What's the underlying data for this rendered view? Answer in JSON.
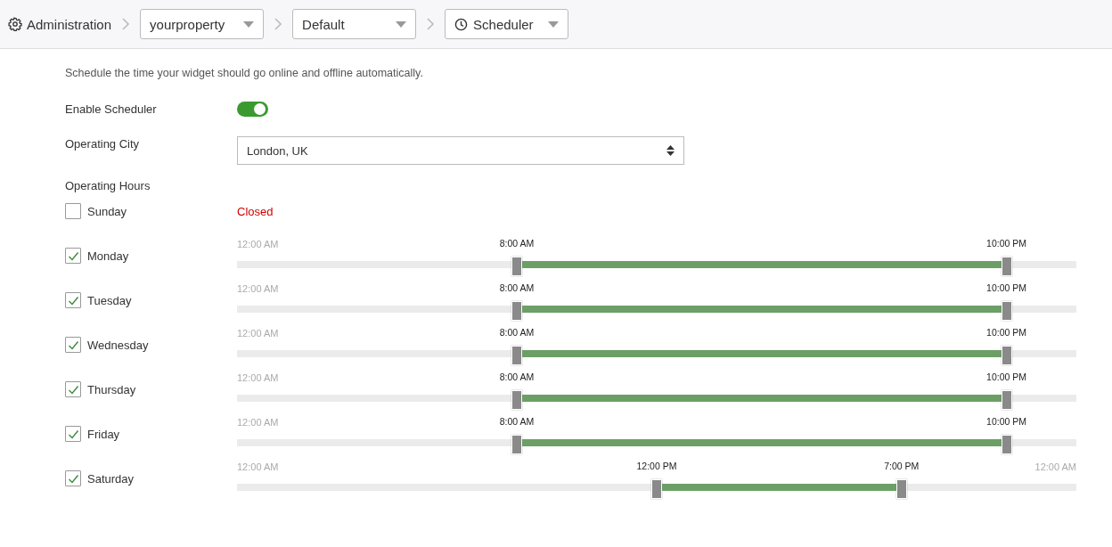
{
  "breadcrumb": {
    "root": "Administration",
    "dropdowns": [
      {
        "kind": "plain",
        "value": "yourproperty"
      },
      {
        "kind": "plain",
        "value": "Default"
      },
      {
        "kind": "clock",
        "value": "Scheduler"
      }
    ]
  },
  "description": "Schedule the time your widget should go online and offline automatically.",
  "enable_scheduler": {
    "label": "Enable Scheduler",
    "on": true
  },
  "operating_city": {
    "label": "Operating City",
    "value": "London, UK"
  },
  "operating_hours": {
    "label": "Operating Hours",
    "days": [
      {
        "name": "Sunday",
        "checked": false,
        "status": "Closed"
      },
      {
        "name": "Monday",
        "checked": true,
        "scale_labels": [
          "12:00 AM"
        ],
        "thumbs": [
          {
            "label": "8:00 AM",
            "level": 0.3333
          },
          {
            "label": "10:00 PM",
            "level": 0.9167
          }
        ]
      },
      {
        "name": "Tuesday",
        "checked": true,
        "scale_labels": [
          "12:00 AM"
        ],
        "thumbs": [
          {
            "label": "8:00 AM",
            "level": 0.3333
          },
          {
            "label": "10:00 PM",
            "level": 0.9167
          }
        ]
      },
      {
        "name": "Wednesday",
        "checked": true,
        "scale_labels": [
          "12:00 AM"
        ],
        "thumbs": [
          {
            "label": "8:00 AM",
            "level": 0.3333
          },
          {
            "label": "10:00 PM",
            "level": 0.9167
          }
        ]
      },
      {
        "name": "Thursday",
        "checked": true,
        "scale_labels": [
          "12:00 AM"
        ],
        "thumbs": [
          {
            "label": "8:00 AM",
            "level": 0.3333
          },
          {
            "label": "10:00 PM",
            "level": 0.9167
          }
        ]
      },
      {
        "name": "Friday",
        "checked": true,
        "scale_labels": [
          "12:00 AM"
        ],
        "thumbs": [
          {
            "label": "8:00 AM",
            "level": 0.3333
          },
          {
            "label": "10:00 PM",
            "level": 0.9167
          }
        ]
      },
      {
        "name": "Saturday",
        "checked": true,
        "scale_labels": [
          "12:00 AM",
          "12:00 AM"
        ],
        "thumbs": [
          {
            "label": "12:00 PM",
            "level": 0.5
          },
          {
            "label": "7:00 PM",
            "level": 0.7917
          }
        ]
      }
    ]
  }
}
